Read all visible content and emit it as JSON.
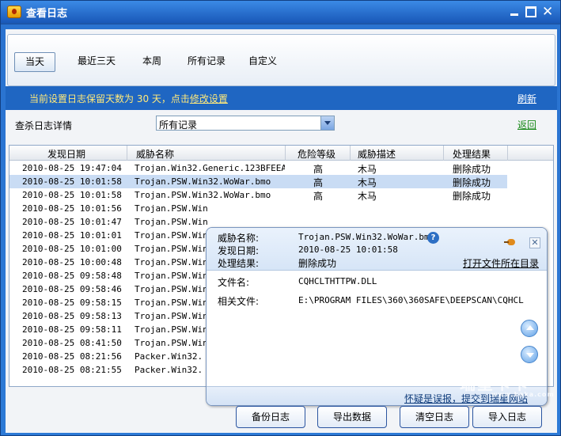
{
  "window": {
    "title": "查看日志"
  },
  "tabs": [
    {
      "label": "当天",
      "active": true
    },
    {
      "label": "最近三天",
      "active": false
    },
    {
      "label": "本周",
      "active": false
    },
    {
      "label": "所有记录",
      "active": false
    },
    {
      "label": "自定义",
      "active": false
    }
  ],
  "notice": {
    "text": "当前设置日志保留天数为 30 天，点击",
    "link": "修改设置",
    "refresh": "刷新"
  },
  "filter": {
    "label": "查杀日志详情",
    "selected": "所有记录",
    "back": "返回"
  },
  "table": {
    "headers": [
      "发现日期",
      "威胁名称",
      "危险等级",
      "威胁描述",
      "处理结果"
    ],
    "rows": [
      {
        "date": "2010-08-25 19:47:04",
        "name": "Trojan.Win32.Generic.123BFEEA",
        "level": "高",
        "desc": "木马",
        "result": "删除成功"
      },
      {
        "date": "2010-08-25 10:01:58",
        "name": "Trojan.PSW.Win32.WoWar.bmo",
        "level": "高",
        "desc": "木马",
        "result": "删除成功",
        "selected": true
      },
      {
        "date": "2010-08-25 10:01:58",
        "name": "Trojan.PSW.Win32.WoWar.bmo",
        "level": "高",
        "desc": "木马",
        "result": "删除成功"
      },
      {
        "date": "2010-08-25 10:01:56",
        "name": "Trojan.PSW.Win",
        "level": "",
        "desc": "",
        "result": ""
      },
      {
        "date": "2010-08-25 10:01:47",
        "name": "Trojan.PSW.Win",
        "level": "",
        "desc": "",
        "result": ""
      },
      {
        "date": "2010-08-25 10:01:01",
        "name": "Trojan.PSW.Win",
        "level": "",
        "desc": "",
        "result": ""
      },
      {
        "date": "2010-08-25 10:01:00",
        "name": "Trojan.PSW.Win",
        "level": "",
        "desc": "",
        "result": ""
      },
      {
        "date": "2010-08-25 10:00:48",
        "name": "Trojan.PSW.Win",
        "level": "",
        "desc": "",
        "result": ""
      },
      {
        "date": "2010-08-25 09:58:48",
        "name": "Trojan.PSW.Win",
        "level": "",
        "desc": "",
        "result": ""
      },
      {
        "date": "2010-08-25 09:58:46",
        "name": "Trojan.PSW.Win",
        "level": "",
        "desc": "",
        "result": ""
      },
      {
        "date": "2010-08-25 09:58:15",
        "name": "Trojan.PSW.Win",
        "level": "",
        "desc": "",
        "result": ""
      },
      {
        "date": "2010-08-25 09:58:13",
        "name": "Trojan.PSW.Win",
        "level": "",
        "desc": "",
        "result": ""
      },
      {
        "date": "2010-08-25 09:58:11",
        "name": "Trojan.PSW.Win",
        "level": "",
        "desc": "",
        "result": ""
      },
      {
        "date": "2010-08-25 08:41:50",
        "name": "Trojan.PSW.Win",
        "level": "",
        "desc": "",
        "result": ""
      },
      {
        "date": "2010-08-25 08:21:56",
        "name": "Packer.Win32.",
        "level": "",
        "desc": "",
        "result": ""
      },
      {
        "date": "2010-08-25 08:21:55",
        "name": "Packer.Win32.",
        "level": "",
        "desc": "",
        "result": ""
      }
    ]
  },
  "detail": {
    "threat_label": "威胁名称:",
    "threat_value": "Trojan.PSW.Win32.WoWar.bmo",
    "date_label": "发现日期:",
    "date_value": "2010-08-25 10:01:58",
    "result_label": "处理结果:",
    "result_value": "删除成功",
    "open_folder": "打开文件所在目录",
    "file_label": "文件名:",
    "file_value": "CQHCLTHTTPW.DLL",
    "related_label": "相关文件:",
    "related_value": "E:\\PROGRAM FILES\\360\\360SAFE\\DEEPSCAN\\CQHCL",
    "report": "怀疑是误报，提交到瑞星网站",
    "help": "?",
    "close": "✕"
  },
  "buttons": {
    "backup": "备份日志",
    "export": "导出数据",
    "clear": "清空日志",
    "import": "导入日志"
  },
  "watermark": {
    "text": "瑞星卡卡",
    "sub": "www.kaka.com"
  }
}
